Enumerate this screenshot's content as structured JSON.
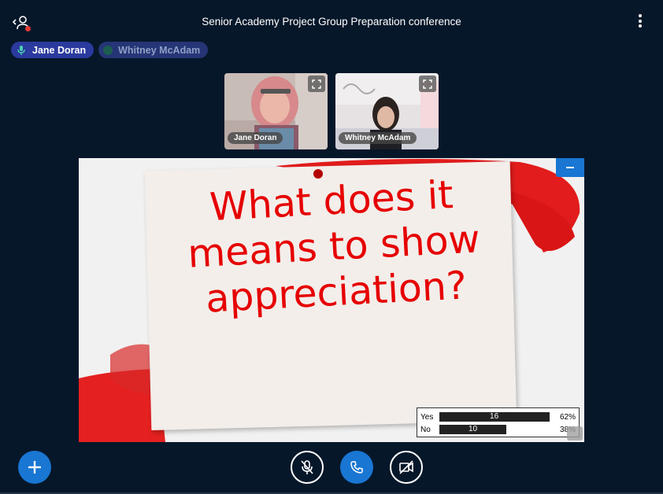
{
  "header": {
    "title": "Senior Academy Project Group Preparation conference",
    "users_icon": "user-list-icon",
    "more_icon": "more-vertical-icon"
  },
  "talking_indicators": [
    {
      "name": "Jane Doran",
      "icon": "microphone-icon",
      "active": true
    },
    {
      "name": "Whitney McAdam",
      "icon": "dot-icon",
      "active": false
    }
  ],
  "videos": [
    {
      "name": "Jane Doran",
      "icon": "expand-icon"
    },
    {
      "name": "Whitney McAdam",
      "icon": "expand-icon"
    }
  ],
  "slide": {
    "line1": "What does it",
    "line2": "means to show",
    "line3": "appreciation?"
  },
  "poll": {
    "rows": [
      {
        "label": "Yes",
        "count": "16",
        "percent": "62%",
        "fraction": 0.62
      },
      {
        "label": "No",
        "count": "10",
        "percent": "38%",
        "fraction": 0.38
      }
    ]
  },
  "controls": {
    "actions_icon": "plus-icon",
    "mic_icon": "microphone-muted-icon",
    "audio_icon": "phone-icon",
    "video_icon": "camera-off-icon"
  },
  "colors": {
    "background": "#06172a",
    "accent": "#1976d2",
    "slide_text": "#e60000",
    "user_dot": "#e53935"
  }
}
